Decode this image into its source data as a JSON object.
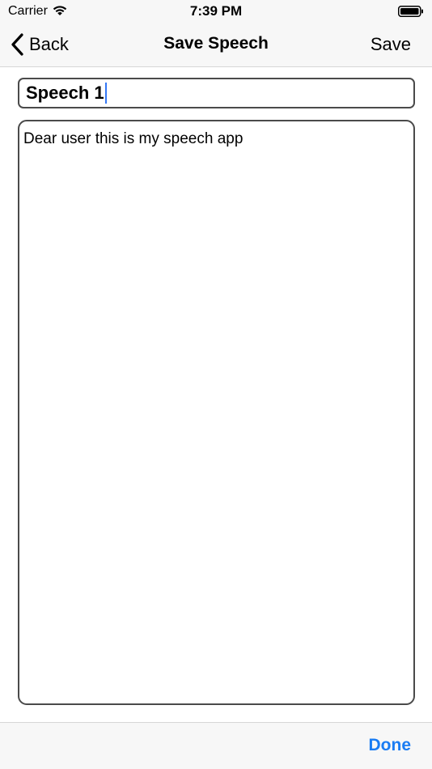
{
  "status_bar": {
    "carrier": "Carrier",
    "time": "7:39 PM",
    "icons": [
      "wifi-icon",
      "battery-icon"
    ]
  },
  "nav": {
    "back_label": "Back",
    "title": "Save Speech",
    "save_label": "Save"
  },
  "form": {
    "title_value": "Speech 1",
    "speech_text": "Dear user this is my speech app"
  },
  "toolbar": {
    "done_label": "Done"
  },
  "colors": {
    "accent": "#1a7cf3",
    "bar_background": "#f7f7f7",
    "field_border": "#4a4a4a"
  }
}
